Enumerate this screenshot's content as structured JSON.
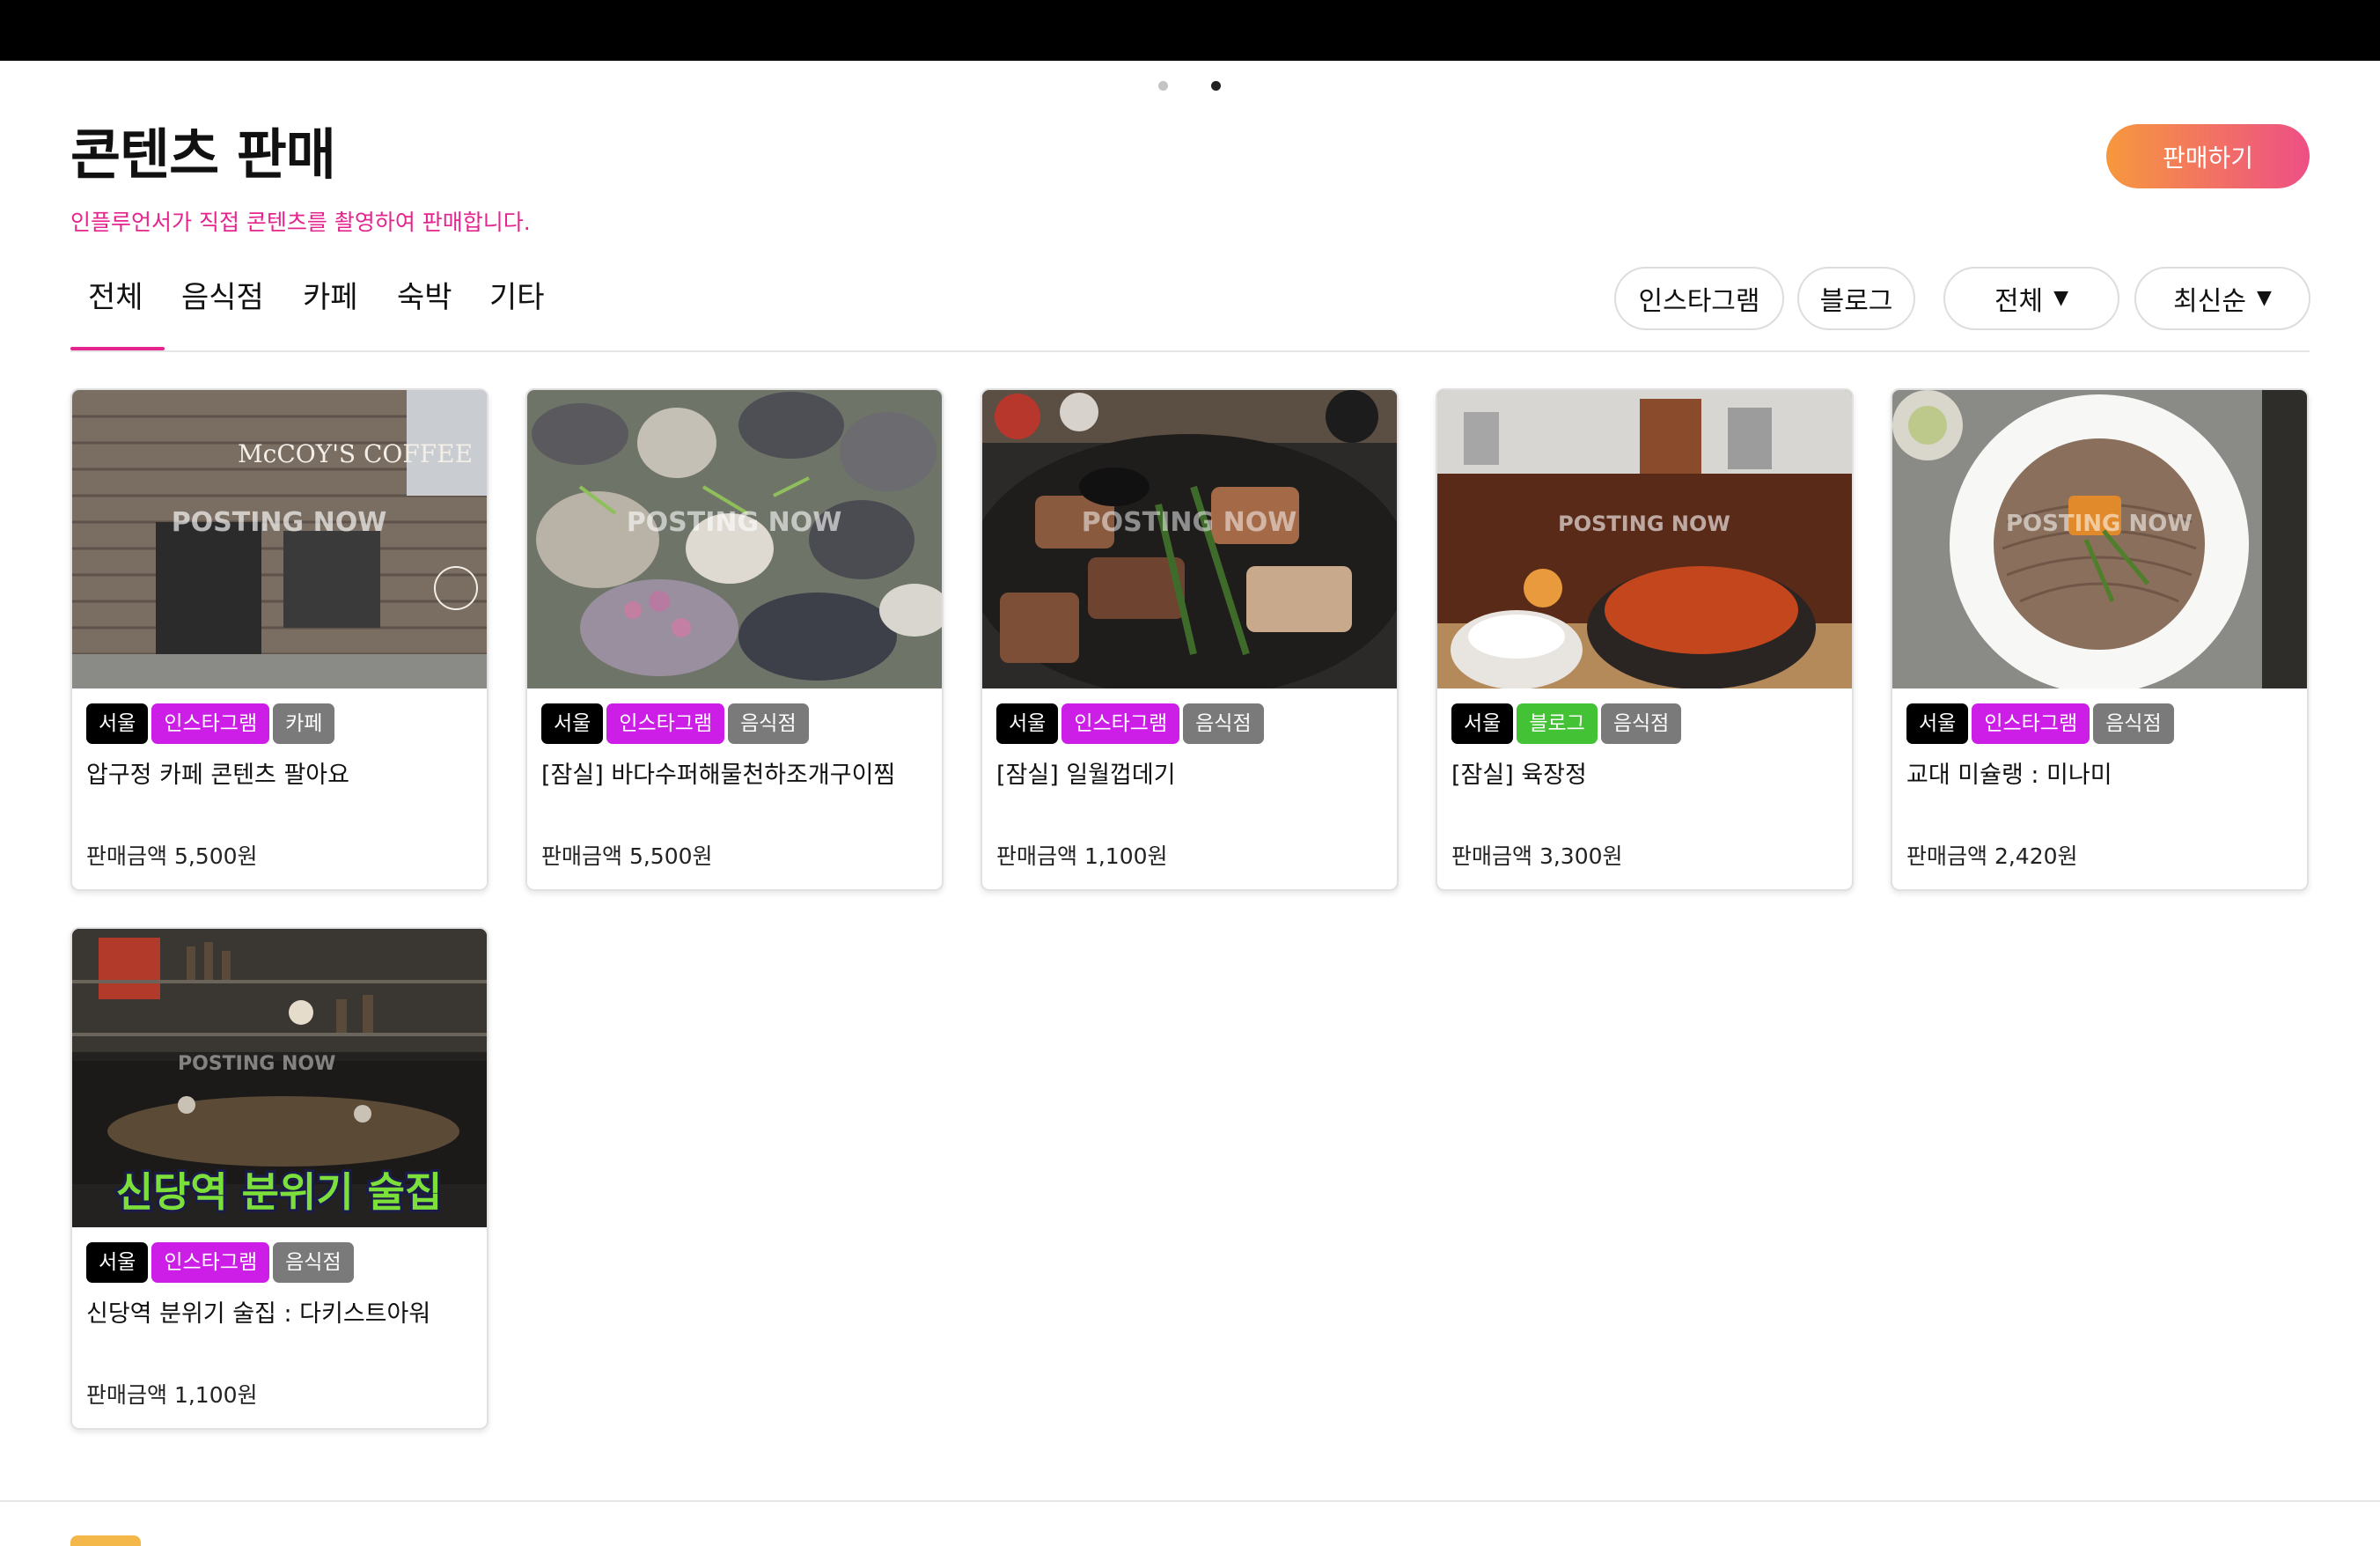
{
  "header": {
    "title": "콘텐츠 판매",
    "subtitle": "인플루언서가 직접 콘텐츠를 촬영하여 판매합니다.",
    "sell_button": "판매하기",
    "carousel": {
      "count": 2,
      "active_index": 1
    }
  },
  "tabs": [
    {
      "label": "전체",
      "active": true
    },
    {
      "label": "음식점",
      "active": false
    },
    {
      "label": "카페",
      "active": false
    },
    {
      "label": "숙박",
      "active": false
    },
    {
      "label": "기타",
      "active": false
    }
  ],
  "filters": {
    "platform_instagram": "인스타그램",
    "platform_blog": "블로그",
    "region_select": "전체",
    "sort_select": "최신순"
  },
  "colors": {
    "accent": "#e5248e",
    "button_gradient_start": "#f6983d",
    "button_gradient_end": "#ee4f86",
    "tag_region": "#000000",
    "tag_instagram": "#cc1ee6",
    "tag_blog": "#44c236",
    "tag_category": "#7a7a7a"
  },
  "cards": [
    {
      "image": "cafe storefront photo",
      "watermark": "POSTING NOW",
      "sign_text": "McCOY'S COFFEE",
      "tags": [
        "서울",
        "인스타그램",
        "카페"
      ],
      "title": "압구정 카페 콘텐츠 팔아요",
      "price": "판매금액 5,500원"
    },
    {
      "image": "steamed clams and seafood photo",
      "watermark": "POSTING NOW",
      "tags": [
        "서울",
        "인스타그램",
        "음식점"
      ],
      "title": "[잠실] 바다수퍼해물천하조개구이찜",
      "price": "판매금액 5,500원"
    },
    {
      "image": "grilled pork belly photo",
      "watermark": "POSTING NOW",
      "tags": [
        "서울",
        "인스타그램",
        "음식점"
      ],
      "title": "[잠실] 일월껍데기",
      "price": "판매금액 1,100원"
    },
    {
      "image": "spicy beef soup meal photo",
      "watermark": "POSTING NOW",
      "tags": [
        "서울",
        "블로그",
        "음식점"
      ],
      "title": "[잠실] 육장정",
      "price": "판매금액 3,300원"
    },
    {
      "image": "cold buckwheat noodles photo",
      "watermark": "POSTING NOW",
      "tags": [
        "서울",
        "인스타그램",
        "음식점"
      ],
      "title": "교대 미슐랭 : 미나미",
      "price": "판매금액 2,420원"
    },
    {
      "image": "dark cocktail bar interior photo",
      "watermark": "POSTING NOW",
      "overlay_text": "신당역 분위기 술집",
      "tags": [
        "서울",
        "인스타그램",
        "음식점"
      ],
      "title": "신당역 분위기 술집 : 다키스트아워",
      "price": "판매금액 1,100원"
    }
  ]
}
